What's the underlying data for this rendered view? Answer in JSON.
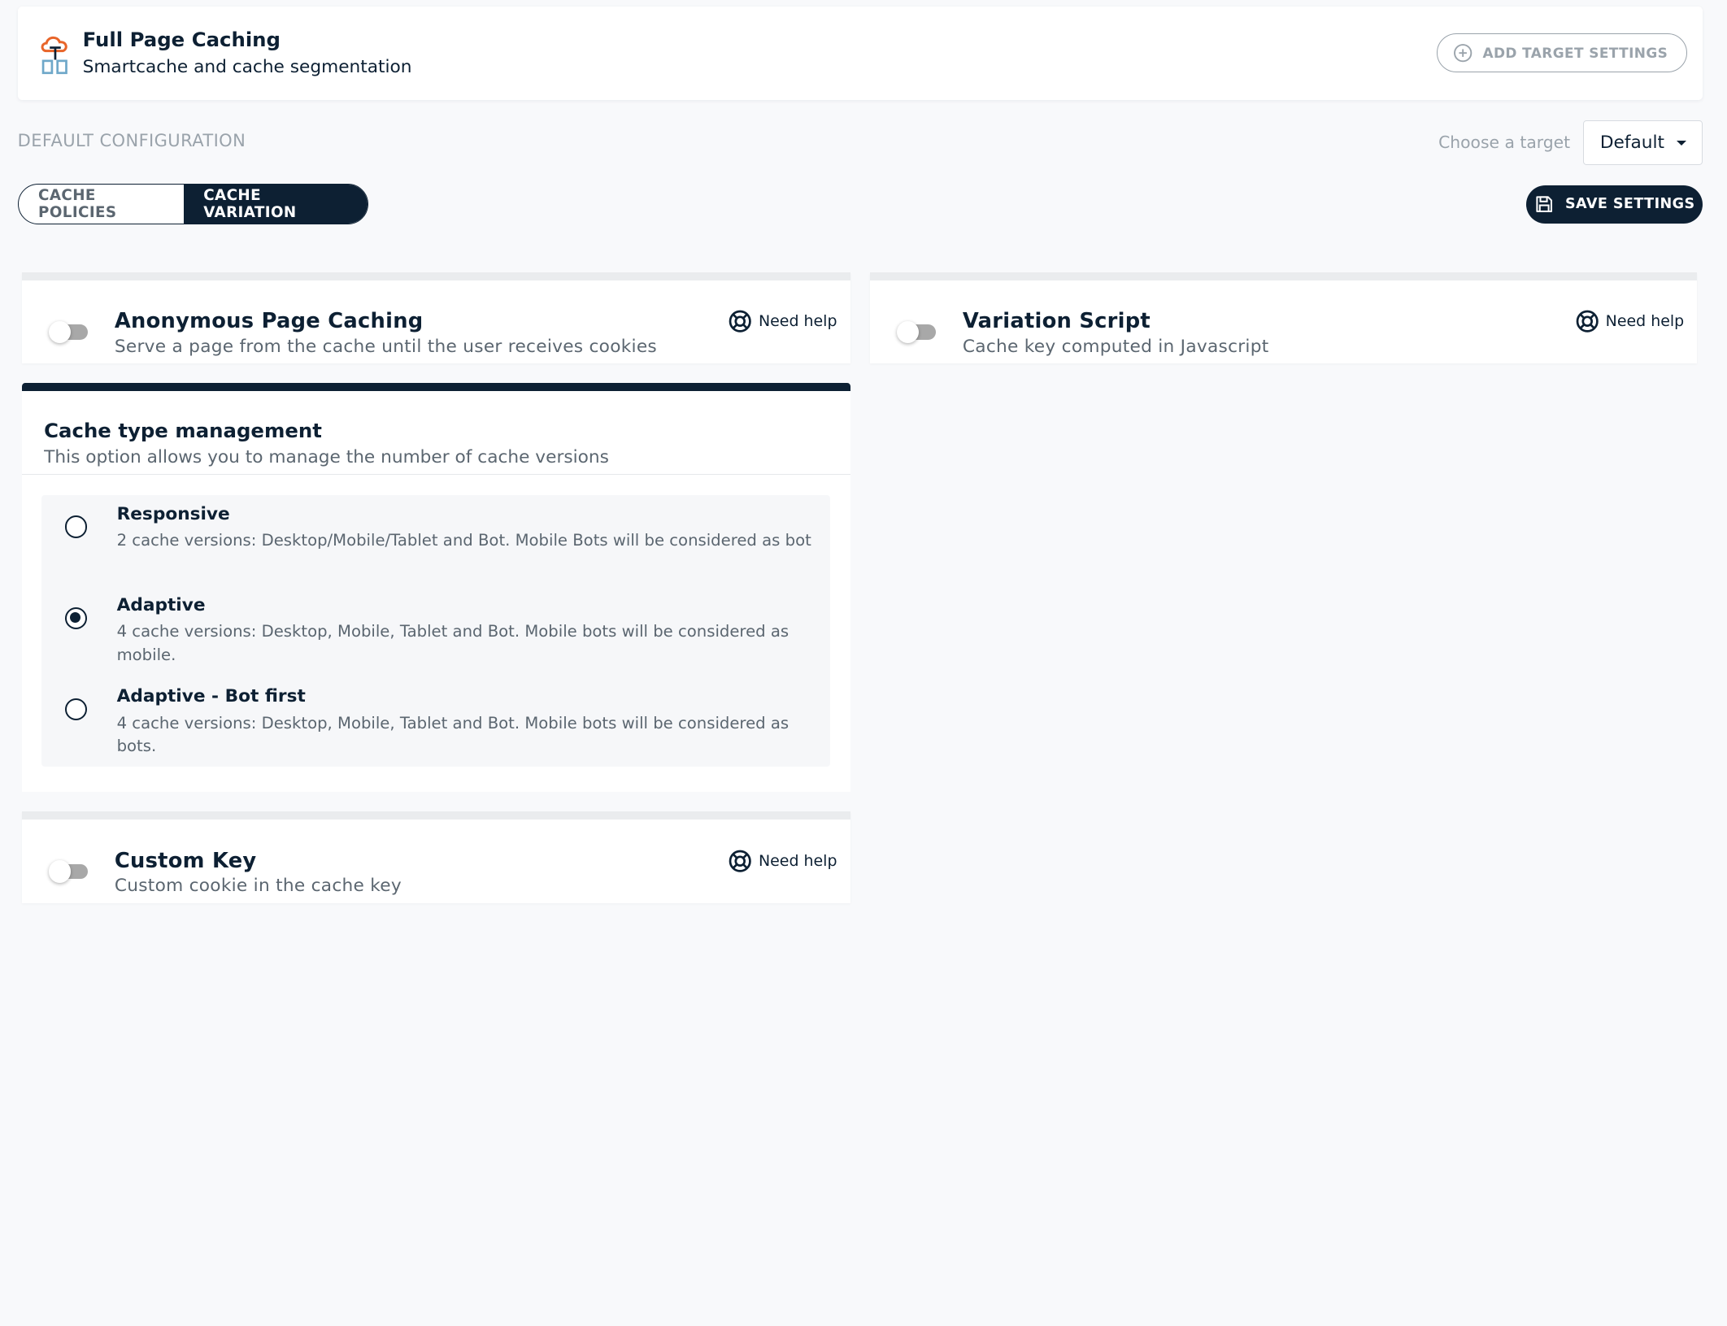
{
  "header": {
    "title": "Full Page Caching",
    "subtitle": "Smartcache and cache segmentation",
    "add_target_label": "ADD TARGET SETTINGS"
  },
  "config": {
    "label": "DEFAULT CONFIGURATION",
    "choose_target_label": "Choose a target",
    "target_value": "Default"
  },
  "tabs": [
    {
      "label": "CACHE POLICIES",
      "active": false
    },
    {
      "label": "CACHE VARIATION",
      "active": true
    }
  ],
  "save_label": "SAVE SETTINGS",
  "features": {
    "anonymous": {
      "title": "Anonymous Page Caching",
      "subtitle": "Serve a page from the cache until the user receives cookies",
      "enabled": false,
      "help": "Need help"
    },
    "variation_script": {
      "title": "Variation Script",
      "subtitle": "Cache key computed in Javascript",
      "enabled": false,
      "help": "Need help"
    },
    "custom_key": {
      "title": "Custom Key",
      "subtitle": "Custom cookie in the cache key",
      "enabled": false,
      "help": "Need help"
    }
  },
  "cache_type": {
    "title": "Cache type management",
    "subtitle": "This option allows you to manage the number of cache versions",
    "options": [
      {
        "title": "Responsive",
        "description": "2 cache versions: Desktop/Mobile/Tablet and Bot. Mobile Bots will be considered as bot",
        "selected": false
      },
      {
        "title": "Adaptive",
        "description": "4 cache versions: Desktop, Mobile, Tablet and Bot. Mobile bots will be considered as mobile.",
        "selected": true
      },
      {
        "title": "Adaptive - Bot first",
        "description": "4 cache versions: Desktop, Mobile, Tablet and Bot. Mobile bots will be considered as bots.",
        "selected": false
      }
    ]
  },
  "colors": {
    "primary": "#0d2033",
    "muted": "#9aa3ab",
    "logo_orange": "#e8652a",
    "logo_blue": "#6fa8c9"
  }
}
